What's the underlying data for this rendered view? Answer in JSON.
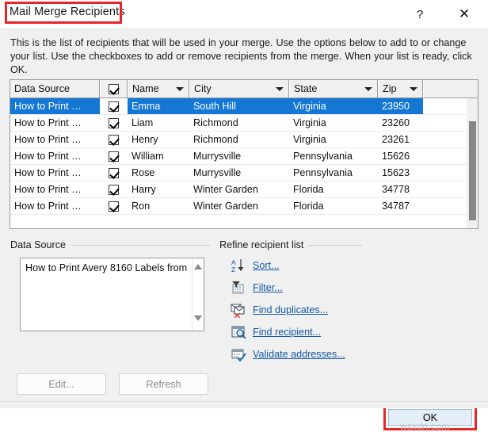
{
  "window": {
    "title": "Mail Merge Recipients",
    "help_icon": "?",
    "close_icon": "✕",
    "title_highlight_color": "#e8262a"
  },
  "intro": {
    "text": "This is the list of recipients that will be used in your merge.  Use the options below to add to or change your list.  Use the checkboxes to add or remove recipients from the merge.  When your list is ready, click OK."
  },
  "grid": {
    "columns": [
      {
        "label": "Data Source",
        "has_dropdown": false
      },
      {
        "label": "",
        "has_dropdown": false,
        "is_checkbox": true
      },
      {
        "label": "Name",
        "has_dropdown": true
      },
      {
        "label": "City",
        "has_dropdown": true
      },
      {
        "label": "State",
        "has_dropdown": true
      },
      {
        "label": "Zip",
        "has_dropdown": true
      }
    ],
    "header_checkbox_checked": true,
    "rows": [
      {
        "source": "How to Print …",
        "checked": true,
        "name": "Emma",
        "city": "South Hill",
        "state": "Virginia",
        "zip": "23950",
        "selected": true
      },
      {
        "source": "How to Print …",
        "checked": true,
        "name": "Liam",
        "city": "Richmond",
        "state": "Virginia",
        "zip": "23260",
        "selected": false
      },
      {
        "source": "How to Print …",
        "checked": true,
        "name": "Henry",
        "city": "Richmond",
        "state": "Virginia",
        "zip": "23261",
        "selected": false
      },
      {
        "source": "How to Print …",
        "checked": true,
        "name": "William",
        "city": "Murrysville",
        "state": "Pennsylvania",
        "zip": "15626",
        "selected": false
      },
      {
        "source": "How to Print …",
        "checked": true,
        "name": "Rose",
        "city": "Murrysville",
        "state": "Pennsylvania",
        "zip": "15623",
        "selected": false
      },
      {
        "source": "How to Print …",
        "checked": true,
        "name": "Harry",
        "city": "Winter Garden",
        "state": "Florida",
        "zip": "34778",
        "selected": false
      },
      {
        "source": "How to Print …",
        "checked": true,
        "name": "Ron",
        "city": "Winter Garden",
        "state": "Florida",
        "zip": "34787",
        "selected": false
      }
    ],
    "selection_color": "#1477d3"
  },
  "data_source": {
    "group_label": "Data Source",
    "items": [
      "How to Print Avery 8160 Labels from"
    ],
    "edit_label": "Edit...",
    "refresh_label": "Refresh",
    "buttons_enabled": false
  },
  "refine": {
    "group_label": "Refine recipient list",
    "items": [
      {
        "label": "Sort...",
        "icon": "sort-az-icon"
      },
      {
        "label": "Filter...",
        "icon": "filter-icon"
      },
      {
        "label": "Find duplicates...",
        "icon": "find-duplicates-icon"
      },
      {
        "label": "Find recipient...",
        "icon": "find-recipient-icon"
      },
      {
        "label": "Validate addresses...",
        "icon": "validate-addresses-icon"
      }
    ],
    "link_color": "#1358a6"
  },
  "footer": {
    "ok_label": "OK",
    "ok_highlight_color": "#e8262a",
    "watermark": "wsxdn.com"
  }
}
